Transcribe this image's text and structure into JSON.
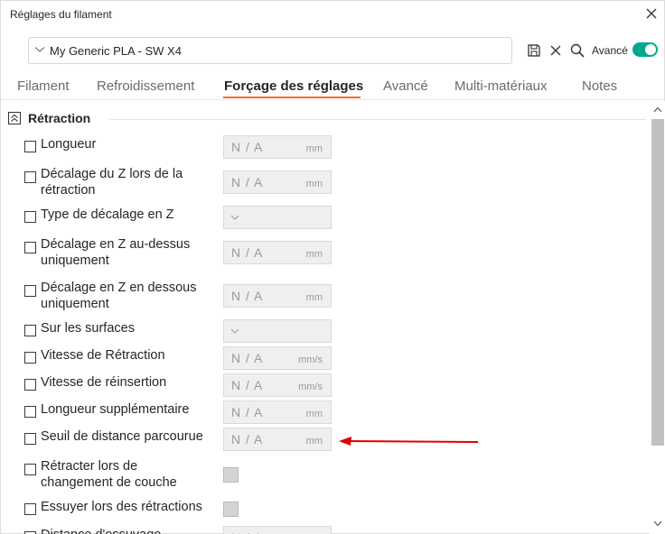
{
  "window": {
    "title": "Réglages du filament"
  },
  "toolbar": {
    "preset_name": "My Generic PLA - SW X4",
    "advanced_label": "Avancé",
    "advanced_on": true,
    "accent_color": "#00a88f"
  },
  "tabs": [
    {
      "label": "Filament",
      "active": false
    },
    {
      "label": "Refroidissement",
      "active": false
    },
    {
      "label": "Forçage des réglages",
      "active": true
    },
    {
      "label": "Avancé",
      "active": false
    },
    {
      "label": "Multi-matériaux",
      "active": false
    },
    {
      "label": "Notes",
      "active": false
    }
  ],
  "tab_accent_color": "#f26c2a",
  "section": {
    "title": "Rétraction",
    "icon": "collapse-icon"
  },
  "settings": [
    {
      "label_lines": [
        "Longueur"
      ],
      "control": "number",
      "value": "N/A",
      "unit": "mm",
      "checked": false
    },
    {
      "label_lines": [
        "Décalage du Z lors de la",
        "rétraction"
      ],
      "control": "number",
      "value": "N/A",
      "unit": "mm",
      "checked": false
    },
    {
      "label_lines": [
        "Type de décalage en Z"
      ],
      "control": "select",
      "value": "",
      "unit": "",
      "checked": false
    },
    {
      "label_lines": [
        "Décalage en Z au-dessus",
        "uniquement"
      ],
      "control": "number",
      "value": "N/A",
      "unit": "mm",
      "checked": false
    },
    {
      "label_lines": [
        "Décalage en Z en dessous",
        "uniquement"
      ],
      "control": "number",
      "value": "N/A",
      "unit": "mm",
      "checked": false
    },
    {
      "label_lines": [
        "Sur les surfaces"
      ],
      "control": "select",
      "value": "",
      "unit": "",
      "checked": false
    },
    {
      "label_lines": [
        "Vitesse de Rétraction"
      ],
      "control": "number",
      "value": "N/A",
      "unit": "mm/s",
      "checked": false
    },
    {
      "label_lines": [
        "Vitesse de réinsertion"
      ],
      "control": "number",
      "value": "N/A",
      "unit": "mm/s",
      "checked": false
    },
    {
      "label_lines": [
        "Longueur supplémentaire"
      ],
      "control": "number",
      "value": "N/A",
      "unit": "mm",
      "checked": false
    },
    {
      "label_lines": [
        "Seuil de distance parcourue"
      ],
      "control": "number",
      "value": "N/A",
      "unit": "mm",
      "checked": false
    },
    {
      "label_lines": [
        "Rétracter lors de",
        "changement de couche"
      ],
      "control": "bool",
      "value": "",
      "unit": "",
      "checked": false
    },
    {
      "label_lines": [
        "Essuyer lors des rétractions"
      ],
      "control": "bool",
      "value": "",
      "unit": "",
      "checked": false
    },
    {
      "label_lines": [
        "Distance d'essuyage"
      ],
      "control": "number",
      "value": "N/A",
      "unit": "mm",
      "checked": false
    }
  ],
  "annotation": {
    "arrow_color": "#e00000",
    "points_to": "Seuil de distance parcourue"
  }
}
